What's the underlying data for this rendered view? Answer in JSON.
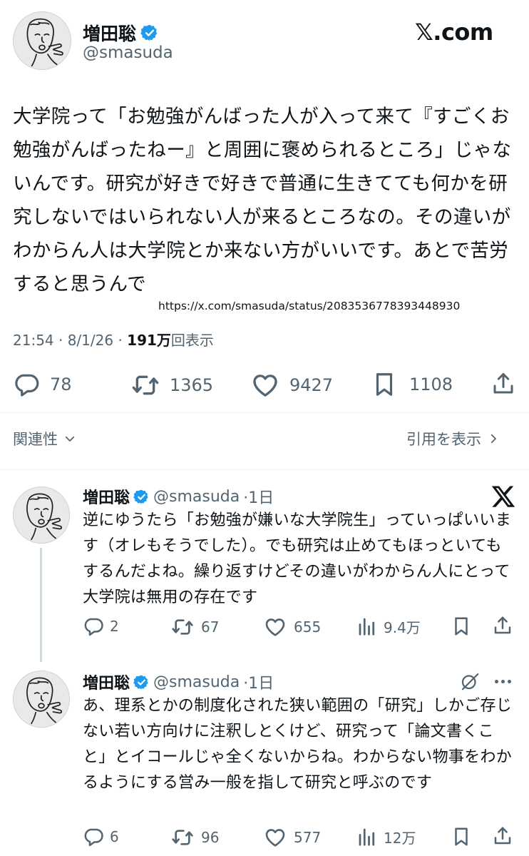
{
  "main": {
    "author_name": "増田聡",
    "author_handle": "@smasuda",
    "brand": "𝕏.com",
    "text": "大学院って「お勉強がんばった人が入って来て『すごくお勉強がんばったねー』と周囲に褒められるところ」じゃないんです。研究が好きで好きで普通に生きてても何かを研究しないではいられない人が来るところなの。その違いがわからん人は大学院とか来ない方がいいです。あとで苦労すると思うんで",
    "url": "https://x.com/smasuda/status/2083536778393448930",
    "time": "21:54 · 8/1/26 · ",
    "views_count": "191万",
    "views_label": "回表示",
    "replies": "78",
    "reposts": "1365",
    "likes": "9427",
    "bookmarks": "1108"
  },
  "related": {
    "label": "関連性",
    "quotes_link": "引用を表示"
  },
  "replies": [
    {
      "name": "増田聡",
      "handle": "@smasuda",
      "age": "·1日",
      "text": "逆にゆうたら「お勉強が嫌いな大学院生」っていっぱいいます（オレもそうでした）。でも研究は止めてもほっといてもするんだよね。繰り返すけどその違いがわからん人にとって大学院は無用の存在です",
      "replies": "2",
      "reposts": "67",
      "likes": "655",
      "views": "9.4万"
    },
    {
      "name": "増田聡",
      "handle": "@smasuda",
      "age": "·1日",
      "text": "あ、理系とかの制度化された狭い範囲の「研究」しかご存じない若い方向けに注釈しとくけど、研究って「論文書くこと」とイコールじゃ全くないからね。わからない物事をわかるようにする営み一般を指して研究と呼ぶのです",
      "replies": "6",
      "reposts": "96",
      "likes": "577",
      "views": "12万"
    }
  ],
  "icons": {
    "verified": "verified-badge-icon",
    "reply": "speech-bubble-icon",
    "repost": "repost-arrows-icon",
    "like": "heart-icon",
    "bookmark": "bookmark-icon",
    "share": "share-upload-icon",
    "views": "bar-chart-icon",
    "chevron": "chevron-icon",
    "close": "x-logo-icon",
    "grok": "grok-icon",
    "more": "more-dots-icon"
  },
  "colors": {
    "verified": "#1d9bf0",
    "text": "#0f1419",
    "muted": "#536471"
  }
}
